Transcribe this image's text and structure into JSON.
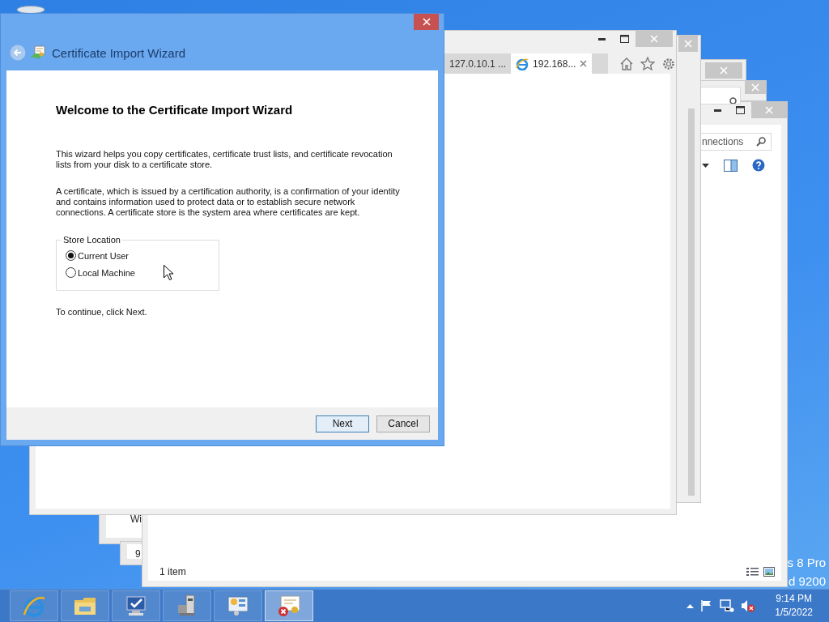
{
  "desktop": {
    "edition_lines": [
      "s 8 Pro",
      "d 9200"
    ]
  },
  "background_windows": [
    {
      "text": "Wi"
    },
    {
      "text": "9"
    }
  ],
  "explorer_window": {
    "search_text": "nnections",
    "status": "1 item"
  },
  "browser_window": {
    "tabs": [
      {
        "label": "127.0.10.1 ...",
        "selected": false
      },
      {
        "label": "192.168...",
        "selected": true
      }
    ]
  },
  "wizard": {
    "title": "Certificate Import Wizard",
    "heading": "Welcome to the Certificate Import Wizard",
    "paragraphs": [
      "This wizard helps you copy certificates, certificate trust lists, and certificate revocation lists from your disk to a certificate store.",
      "A certificate, which is issued by a certification authority, is a confirmation of your identity and contains information used to protect data or to establish secure network connections. A certificate store is the system area where certificates are kept."
    ],
    "store_location": {
      "legend": "Store Location",
      "options": [
        {
          "label": "Current User",
          "selected": true
        },
        {
          "label": "Local Machine",
          "selected": false
        }
      ]
    },
    "continue_text": "To continue, click Next.",
    "buttons": [
      {
        "label": "Next",
        "default": true
      },
      {
        "label": "Cancel",
        "default": false
      }
    ]
  },
  "taskbar": {
    "apps": [
      {
        "kind": "browser",
        "selected": false
      },
      {
        "kind": "folder",
        "selected": false
      },
      {
        "kind": "computer",
        "selected": false
      },
      {
        "kind": "server",
        "selected": false
      },
      {
        "kind": "panel",
        "selected": false
      },
      {
        "kind": "certificate",
        "selected": true
      }
    ],
    "clock": {
      "time": "9:14 PM",
      "date": "1/5/2022"
    }
  }
}
